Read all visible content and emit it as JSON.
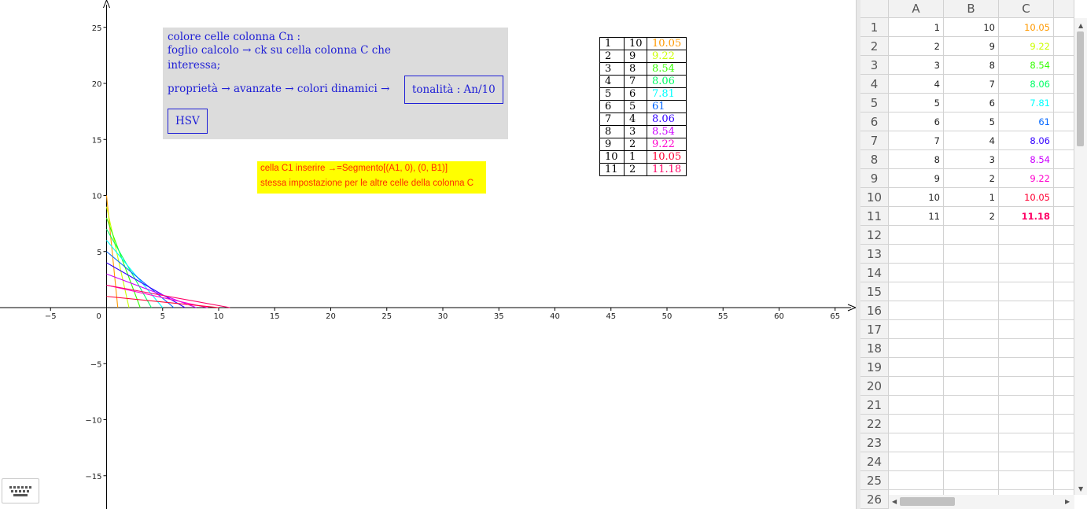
{
  "graphics": {
    "x_ticks": [
      "−5",
      "0",
      "5",
      "10",
      "15",
      "20",
      "25",
      "30",
      "35",
      "40",
      "45",
      "50",
      "55",
      "60",
      "65"
    ],
    "y_ticks": [
      "25",
      "20",
      "15",
      "10",
      "5",
      "−5",
      "−10",
      "−15"
    ]
  },
  "infobox": {
    "line1": "colore celle colonna Cn :",
    "line2": "foglio calcolo  →  ck su cella colonna C che",
    "line3": "interessa;",
    "line4": "proprietà  →  avanzate  →  colori dinamici  →",
    "tonalita_label": "tonalità : An/10",
    "hsv_label": "HSV"
  },
  "note": {
    "line1": "cella C1 inserire →=Segmento[(A1, 0), (0, B1)]",
    "line2": "stessa impostazione per le altre celle della colonna C"
  },
  "colors": {
    "axis": "#000000",
    "info_text": "#1f1fd6",
    "note_bg": "#ffff00",
    "note_text": "#ff2d00",
    "row_colors": [
      "#ff9900",
      "#ccff00",
      "#33ff00",
      "#00ff66",
      "#00ffff",
      "#0066ff",
      "#3300ff",
      "#cc00ff",
      "#ff00cc",
      "#ff0033",
      "#ff0066"
    ]
  },
  "table_rows": [
    {
      "a": "1",
      "b": "10",
      "c": "10.05"
    },
    {
      "a": "2",
      "b": "9",
      "c": "9.22"
    },
    {
      "a": "3",
      "b": "8",
      "c": "8.54"
    },
    {
      "a": "4",
      "b": "7",
      "c": "8.06"
    },
    {
      "a": "5",
      "b": "6",
      "c": "7.81"
    },
    {
      "a": "6",
      "b": "5",
      "c": "61"
    },
    {
      "a": "7",
      "b": "4",
      "c": "8.06"
    },
    {
      "a": "8",
      "b": "3",
      "c": "8.54"
    },
    {
      "a": "9",
      "b": "2",
      "c": "9.22"
    },
    {
      "a": "10",
      "b": "1",
      "c": "10.05"
    },
    {
      "a": "11",
      "b": "2",
      "c": "11.18"
    }
  ],
  "segments": [
    {
      "a": 1,
      "b": 10
    },
    {
      "a": 2,
      "b": 9
    },
    {
      "a": 3,
      "b": 8
    },
    {
      "a": 4,
      "b": 7
    },
    {
      "a": 5,
      "b": 6
    },
    {
      "a": 6,
      "b": 5
    },
    {
      "a": 7,
      "b": 4
    },
    {
      "a": 8,
      "b": 3
    },
    {
      "a": 9,
      "b": 2
    },
    {
      "a": 10,
      "b": 1
    },
    {
      "a": 11,
      "b": 2
    }
  ],
  "spreadsheet": {
    "columns": [
      "A",
      "B",
      "C"
    ],
    "row_numbers": [
      "1",
      "2",
      "3",
      "4",
      "5",
      "6",
      "7",
      "8",
      "9",
      "10",
      "11",
      "12",
      "13",
      "14",
      "15",
      "16",
      "17",
      "18",
      "19",
      "20",
      "21",
      "22",
      "23",
      "24",
      "25",
      "26"
    ]
  }
}
